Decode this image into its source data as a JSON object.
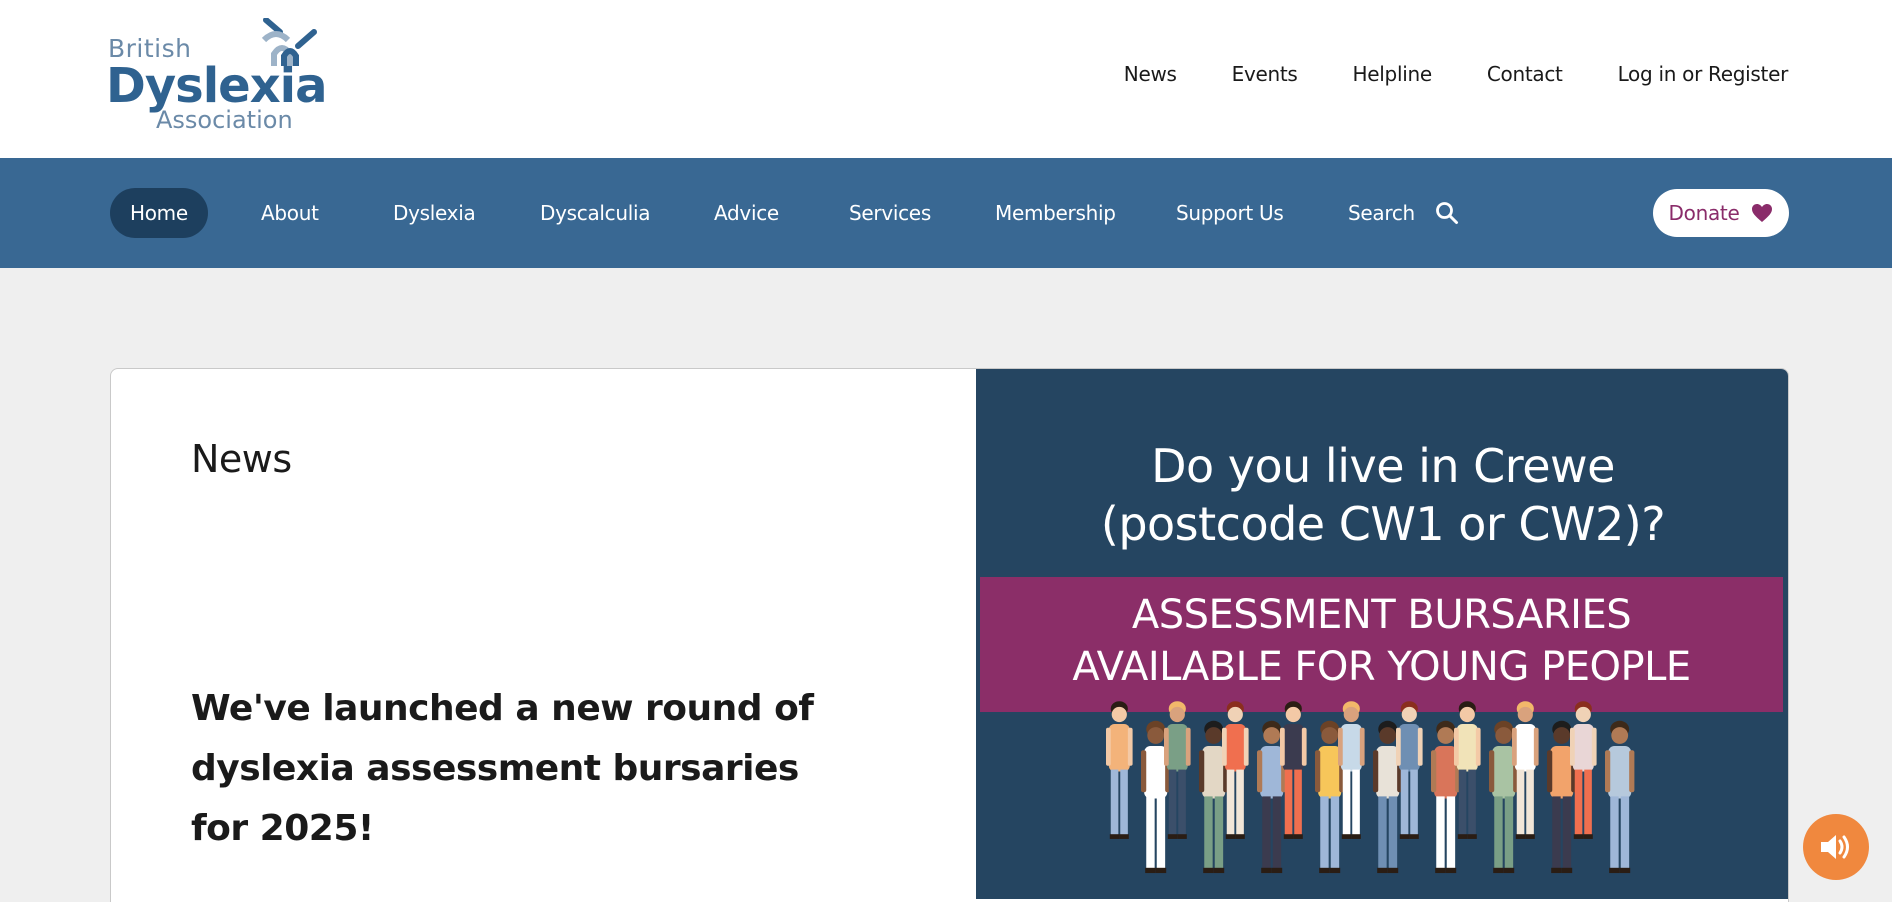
{
  "logo": {
    "line1": "British",
    "line2": "Dyslexia",
    "line3": "Association"
  },
  "utility_nav": [
    "News",
    "Events",
    "Helpline",
    "Contact",
    "Log in or Register"
  ],
  "main_nav": {
    "items": [
      "Home",
      "About",
      "Dyslexia",
      "Dyscalculia",
      "Advice",
      "Services",
      "Membership",
      "Support Us"
    ],
    "active": "Home",
    "search_label": "Search",
    "search_icon": "search-icon",
    "donate_label": "Donate",
    "donate_icon": "heart-icon"
  },
  "feature": {
    "section_label": "News",
    "headline": "We've launched a new round of dyslexia assessment bursaries for 2025!",
    "banner": {
      "question_line1": "Do you live in Crewe",
      "question_line2": "(postcode CW1 or CW2)?",
      "strip_line1": "ASSESSMENT BURSARIES",
      "strip_line2": "AVAILABLE FOR YOUNG PEOPLE"
    }
  },
  "audio_button_icon": "speaker-icon",
  "colors": {
    "nav_blue": "#396893",
    "nav_active": "#1d3f5e",
    "banner_navy": "#254561",
    "banner_purple": "#8b2e68",
    "donate_purple": "#8a2c6a",
    "audio_orange": "#f0883e"
  }
}
